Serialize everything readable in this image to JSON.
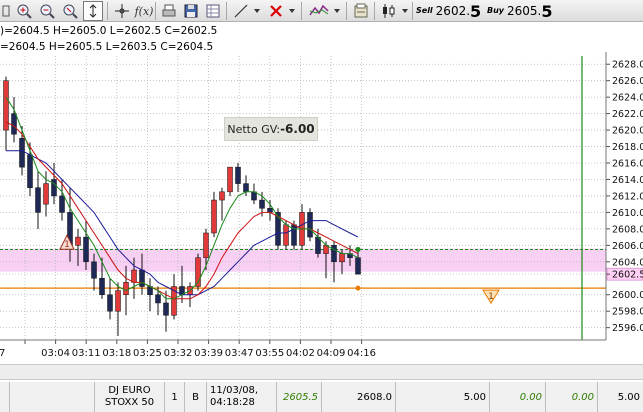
{
  "toolbar": {
    "icons": [
      "chart-icon",
      "zoom-in-icon",
      "zoom-out-icon",
      "zoom-fit-icon",
      "autoscale-icon",
      "crosshair-icon",
      "function-icon",
      "print-icon",
      "save-icon",
      "table-icon",
      "draw-line-icon",
      "dropdown-icon",
      "delete-drawing-icon",
      "dropdown-icon",
      "indicator-icon",
      "dropdown-icon",
      "properties-icon",
      "candlestick-icon",
      "dropdown-icon"
    ],
    "fx_label": "f(x)",
    "sell_label": "Sell",
    "sell_price_base": "2602.",
    "sell_price_last": "5",
    "buy_label": "Buy",
    "buy_price_base": "2605.",
    "buy_price_last": "5"
  },
  "ohlc": {
    "line1": ")=2604.5 H=2605.0 L=2602.5 C=2602.5",
    "line2": "=2604.5 H=2605.5 L=2603.5 C=2604.5"
  },
  "netto": {
    "label": "Netto GV: ",
    "value": "-6.00"
  },
  "colors": {
    "bull": "#e03a3a",
    "bear": "#1e2a55",
    "ma_fast": "#1a8a1a",
    "ma_mid": "#cc1111",
    "ma_slow": "#1a1a99",
    "pink_band": "#f8d0f4",
    "orange": "#e87a00",
    "green_line": "#1a8a1a",
    "price_current": "#ffd0f4"
  },
  "chart_data": {
    "type": "candlestick",
    "y_ticks": [
      "2628.0",
      "2626.0",
      "2624.0",
      "2622.0",
      "2620.0",
      "2618.0",
      "2616.0",
      "2614.0",
      "2612.0",
      "2610.0",
      "2608.0",
      "2606.0",
      "2604.0",
      "2602.5",
      "2600.0",
      "2598.0",
      "2596.0"
    ],
    "x_ticks": [
      "7",
      "03:04",
      "03:11",
      "03:18",
      "03:25",
      "03:32",
      "03:39",
      "03:47",
      "03:55",
      "04:02",
      "04:09",
      "04:16"
    ],
    "ylim": [
      2594.5,
      2629.0
    ],
    "current_price_label": "2602.5",
    "order_marker": "1",
    "order_marker_price": 2600.8,
    "green_level": 2605.5,
    "pink_band": [
      2602.8,
      2605.6
    ],
    "candles": [
      {
        "o": 2620.0,
        "h": 2626.5,
        "l": 2617.5,
        "c": 2626.0
      },
      {
        "o": 2622.0,
        "h": 2624.0,
        "l": 2618.5,
        "c": 2619.5
      },
      {
        "o": 2619.0,
        "h": 2620.5,
        "l": 2614.5,
        "c": 2615.5
      },
      {
        "o": 2617.0,
        "h": 2618.5,
        "l": 2612.0,
        "c": 2613.0
      },
      {
        "o": 2613.0,
        "h": 2615.0,
        "l": 2608.0,
        "c": 2610.0
      },
      {
        "o": 2611.0,
        "h": 2615.0,
        "l": 2609.5,
        "c": 2613.5
      },
      {
        "o": 2614.0,
        "h": 2616.0,
        "l": 2611.0,
        "c": 2612.0
      },
      {
        "o": 2612.0,
        "h": 2614.0,
        "l": 2609.0,
        "c": 2610.0
      },
      {
        "o": 2610.0,
        "h": 2613.0,
        "l": 2604.0,
        "c": 2606.0
      },
      {
        "o": 2606.0,
        "h": 2608.0,
        "l": 2603.5,
        "c": 2607.0
      },
      {
        "o": 2607.0,
        "h": 2609.0,
        "l": 2603.0,
        "c": 2604.0
      },
      {
        "o": 2604.0,
        "h": 2605.0,
        "l": 2600.5,
        "c": 2602.0
      },
      {
        "o": 2602.0,
        "h": 2604.5,
        "l": 2599.5,
        "c": 2600.0
      },
      {
        "o": 2600.0,
        "h": 2602.0,
        "l": 2597.0,
        "c": 2598.0
      },
      {
        "o": 2598.0,
        "h": 2601.5,
        "l": 2595.0,
        "c": 2600.5
      },
      {
        "o": 2600.0,
        "h": 2603.5,
        "l": 2597.5,
        "c": 2601.5
      },
      {
        "o": 2601.5,
        "h": 2604.5,
        "l": 2599.5,
        "c": 2603.0
      },
      {
        "o": 2603.0,
        "h": 2605.0,
        "l": 2600.0,
        "c": 2601.0
      },
      {
        "o": 2601.0,
        "h": 2602.0,
        "l": 2598.0,
        "c": 2600.0
      },
      {
        "o": 2600.0,
        "h": 2601.0,
        "l": 2597.5,
        "c": 2599.0
      },
      {
        "o": 2599.0,
        "h": 2600.5,
        "l": 2595.5,
        "c": 2597.5
      },
      {
        "o": 2597.5,
        "h": 2602.5,
        "l": 2597.0,
        "c": 2601.0
      },
      {
        "o": 2601.0,
        "h": 2603.5,
        "l": 2599.0,
        "c": 2600.0
      },
      {
        "o": 2600.0,
        "h": 2601.5,
        "l": 2598.5,
        "c": 2601.0
      },
      {
        "o": 2601.0,
        "h": 2605.0,
        "l": 2600.5,
        "c": 2604.5
      },
      {
        "o": 2604.5,
        "h": 2608.0,
        "l": 2603.0,
        "c": 2607.5
      },
      {
        "o": 2607.5,
        "h": 2612.5,
        "l": 2607.0,
        "c": 2611.5
      },
      {
        "o": 2611.5,
        "h": 2613.0,
        "l": 2609.0,
        "c": 2612.5
      },
      {
        "o": 2612.5,
        "h": 2615.5,
        "l": 2612.0,
        "c": 2615.5
      },
      {
        "o": 2615.5,
        "h": 2616.0,
        "l": 2612.5,
        "c": 2613.5
      },
      {
        "o": 2613.5,
        "h": 2614.5,
        "l": 2612.0,
        "c": 2612.5
      },
      {
        "o": 2612.5,
        "h": 2613.5,
        "l": 2611.0,
        "c": 2611.5
      },
      {
        "o": 2611.5,
        "h": 2612.5,
        "l": 2609.5,
        "c": 2610.5
      },
      {
        "o": 2610.5,
        "h": 2611.5,
        "l": 2609.0,
        "c": 2610.0
      },
      {
        "o": 2610.0,
        "h": 2610.5,
        "l": 2605.5,
        "c": 2606.0
      },
      {
        "o": 2606.0,
        "h": 2609.0,
        "l": 2605.5,
        "c": 2608.5
      },
      {
        "o": 2608.5,
        "h": 2609.0,
        "l": 2605.5,
        "c": 2606.0
      },
      {
        "o": 2606.0,
        "h": 2611.0,
        "l": 2605.5,
        "c": 2610.0
      },
      {
        "o": 2610.0,
        "h": 2610.5,
        "l": 2606.5,
        "c": 2607.0
      },
      {
        "o": 2607.0,
        "h": 2608.0,
        "l": 2604.5,
        "c": 2605.0
      },
      {
        "o": 2605.0,
        "h": 2606.5,
        "l": 2602.0,
        "c": 2606.0
      },
      {
        "o": 2606.0,
        "h": 2606.5,
        "l": 2601.5,
        "c": 2604.0
      },
      {
        "o": 2604.0,
        "h": 2605.5,
        "l": 2602.5,
        "c": 2605.0
      },
      {
        "o": 2605.0,
        "h": 2606.0,
        "l": 2603.5,
        "c": 2604.5
      },
      {
        "o": 2604.5,
        "h": 2605.5,
        "l": 2602.5,
        "c": 2602.5
      }
    ],
    "ma_fast": [
      2624.0,
      2622.5,
      2620.0,
      2617.5,
      2615.0,
      2614.0,
      2613.5,
      2612.5,
      2610.5,
      2609.0,
      2607.5,
      2606.0,
      2604.0,
      2602.0,
      2601.0,
      2600.5,
      2601.0,
      2601.5,
      2601.0,
      2600.5,
      2599.5,
      2599.5,
      2600.0,
      2600.5,
      2601.5,
      2603.5,
      2606.0,
      2608.5,
      2610.5,
      2612.0,
      2612.5,
      2612.5,
      2612.0,
      2611.0,
      2609.5,
      2608.5,
      2608.0,
      2608.0,
      2608.0,
      2607.0,
      2606.0,
      2605.5,
      2605.0,
      2605.0,
      2604.5
    ],
    "ma_mid": [
      2621.0,
      2620.5,
      2619.5,
      2618.0,
      2616.5,
      2615.5,
      2614.5,
      2613.5,
      2612.0,
      2610.5,
      2609.0,
      2607.5,
      2606.0,
      2604.5,
      2603.0,
      2602.0,
      2601.5,
      2601.5,
      2601.0,
      2600.5,
      2600.0,
      2599.5,
      2599.5,
      2599.5,
      2600.0,
      2601.0,
      2602.5,
      2604.5,
      2606.0,
      2607.5,
      2608.5,
      2609.5,
      2610.0,
      2610.0,
      2609.5,
      2609.0,
      2608.5,
      2608.0,
      2608.0,
      2607.5,
      2607.0,
      2606.5,
      2606.0,
      2605.5,
      2605.0
    ],
    "ma_slow": [
      2617.5,
      2617.5,
      2617.5,
      2617.0,
      2616.5,
      2616.0,
      2615.0,
      2614.0,
      2613.0,
      2612.0,
      2611.0,
      2610.0,
      2608.5,
      2607.0,
      2605.5,
      2604.5,
      2603.5,
      2603.0,
      2602.5,
      2601.5,
      2601.0,
      2600.5,
      2600.0,
      2600.0,
      2600.0,
      2600.5,
      2601.0,
      2602.0,
      2603.0,
      2604.0,
      2605.0,
      2606.0,
      2606.5,
      2607.0,
      2607.5,
      2607.5,
      2608.0,
      2608.5,
      2609.0,
      2609.0,
      2609.0,
      2608.5,
      2608.0,
      2607.5,
      2607.0
    ]
  },
  "order_row": {
    "instrument_line1": "DJ EURO",
    "instrument_line2": "STOXX 50",
    "qty": "1",
    "side": "B",
    "date": "11/03/08,",
    "time": "04:18:28",
    "entry_price": "2605.5",
    "stop_price": "2608.0",
    "val1": "5.00",
    "val2": "0.00",
    "val3": "0.00",
    "val4": "5.00"
  }
}
